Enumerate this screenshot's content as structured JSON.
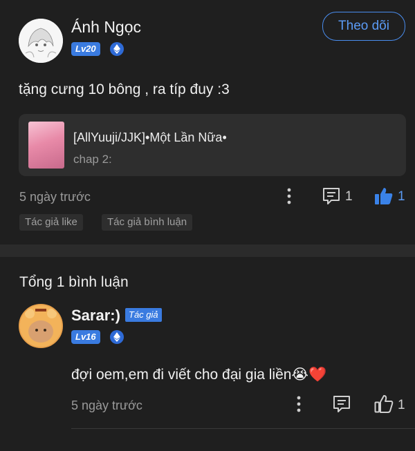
{
  "post": {
    "author": "Ánh Ngọc",
    "level": "Lv20",
    "follow_label": "Theo dõi",
    "content": "tặng cưng 10 bông , ra típ đuy :3",
    "story": {
      "title": "[AllYuuji/JJK]•Một Lần Nữa•",
      "chapter": "chap 2:"
    },
    "time": "5 ngày trước",
    "comment_count": "1",
    "like_count": "1",
    "tags": [
      "Tác giả like",
      "Tác giả bình luận"
    ]
  },
  "comments_header": "Tổng 1 bình luận",
  "comment": {
    "author": "Sarar:)",
    "author_tag": "Tác giả",
    "level": "Lv16",
    "content": "đợi oem,em đi viết cho đại gia liền😭❤️",
    "time": "5 ngày trước",
    "like_count": "1"
  },
  "colors": {
    "accent": "#3a7be0",
    "background": "#1f1f1f",
    "card": "#2e2e2e"
  }
}
